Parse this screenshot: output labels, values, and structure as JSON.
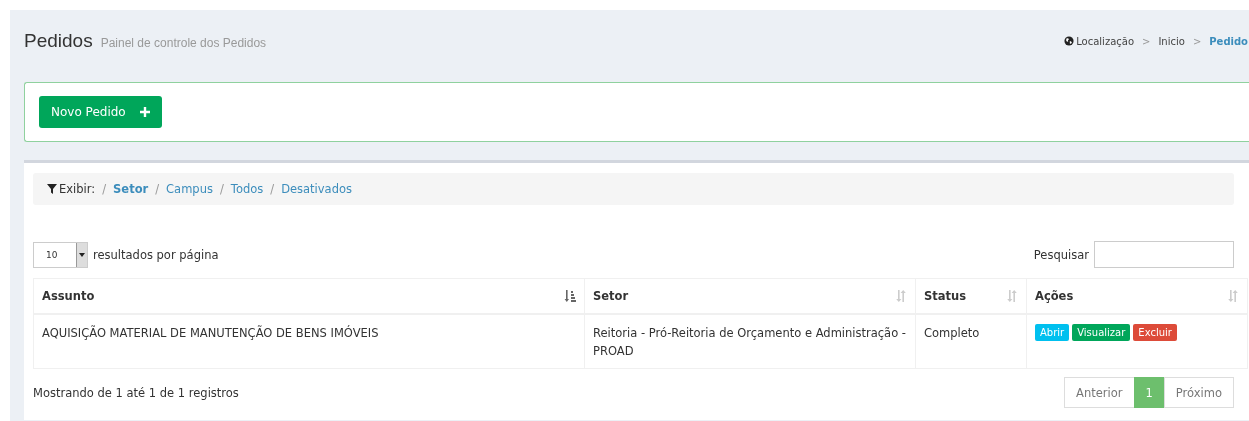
{
  "header": {
    "title": "Pedidos",
    "subtitle": "Painel de controle dos Pedidos"
  },
  "breadcrumb_separator": ">",
  "breadcrumb": [
    {
      "label": "Localização",
      "kind": "location",
      "selected": false
    },
    {
      "label": "Inicio",
      "kind": "link",
      "selected": false
    },
    {
      "label": "Pedido",
      "kind": "link",
      "selected": true
    }
  ],
  "new_button": {
    "label": "Novo Pedido"
  },
  "filter": {
    "label": "Exibir:",
    "separator": "/",
    "items": [
      {
        "label": "Setor",
        "selected": true
      },
      {
        "label": "Campus",
        "selected": false
      },
      {
        "label": "Todos",
        "selected": false
      },
      {
        "label": "Desativados",
        "selected": false
      }
    ]
  },
  "page_size": {
    "value": "10",
    "label": "resultados por página"
  },
  "search": {
    "label": "Pesquisar"
  },
  "table": {
    "columns": [
      {
        "label": "Assunto",
        "sorted": true
      },
      {
        "label": "Setor",
        "sorted": false
      },
      {
        "label": "Status",
        "sorted": false
      },
      {
        "label": "Ações",
        "sorted": false
      }
    ],
    "rows": [
      {
        "assunto": "AQUISIÇÃO MATERIAL DE MANUTENÇÃO DE BENS IMÓVEIS",
        "setor": "Reitoria - Pró-Reitoria de Orçamento e Administração - PROAD",
        "status": "Completo",
        "actions": [
          {
            "label": "Abrir",
            "kind": "info"
          },
          {
            "label": "Visualizar",
            "kind": "success"
          },
          {
            "label": "Excluir",
            "kind": "danger"
          }
        ]
      }
    ]
  },
  "info": "Mostrando de 1 até 1 de 1 registros",
  "pagination": [
    {
      "label": "Anterior",
      "selected": false
    },
    {
      "label": "1",
      "selected": true
    },
    {
      "label": "Próximo",
      "selected": false
    }
  ]
}
